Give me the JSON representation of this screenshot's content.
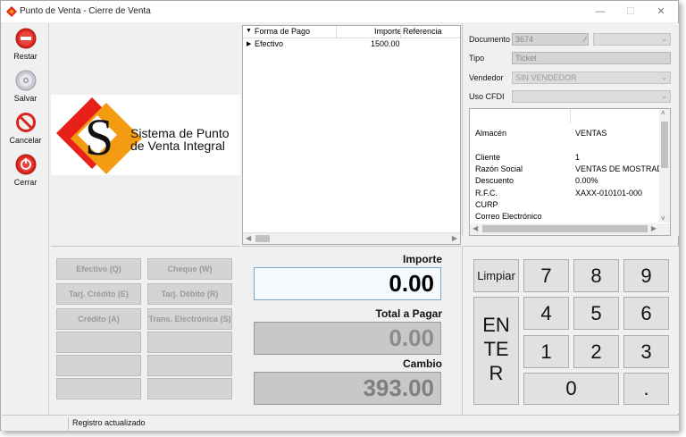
{
  "window": {
    "title": "Punto de Venta - Cierre de Venta",
    "minimize_glyph": "—",
    "maximize_glyph": "☐",
    "close_glyph": "✕"
  },
  "toolbar": {
    "items": [
      {
        "label": "Restar",
        "icon": "minus-circle-icon",
        "color": "#d9261c"
      },
      {
        "label": "Salvar",
        "icon": "disc-icon",
        "color": "#9a9aa6"
      },
      {
        "label": "Cancelar",
        "icon": "no-sign-icon",
        "color": "#d9261c"
      },
      {
        "label": "Cerrar",
        "icon": "power-circle-icon",
        "color": "#d9261c"
      }
    ]
  },
  "logo": {
    "line1": "Sistema de Punto",
    "line2": "de Venta Integral",
    "colors": {
      "red": "#e8201a",
      "orange": "#f39c12"
    }
  },
  "payment_buttons": [
    {
      "label": "Efectivo (Q)"
    },
    {
      "label": "Cheque (W)"
    },
    {
      "label": "Tarj. Crédito (E)"
    },
    {
      "label": "Tarj. Débito (R)"
    },
    {
      "label": "Crédito (A)"
    },
    {
      "label": "Trans. Electrónica (S)"
    },
    {
      "label": ""
    },
    {
      "label": ""
    },
    {
      "label": ""
    },
    {
      "label": ""
    },
    {
      "label": ""
    },
    {
      "label": ""
    }
  ],
  "payments_grid": {
    "headers": {
      "forma": "Forma de Pago",
      "importe": "Importe",
      "referencia": "Referencia"
    },
    "rows": [
      {
        "forma": "Efectivo",
        "importe": "1500.00",
        "referencia": ""
      }
    ]
  },
  "totals": {
    "importe_label": "Importe",
    "importe_value": "0.00",
    "total_label": "Total a Pagar",
    "total_value": "0.00",
    "cambio_label": "Cambio",
    "cambio_value": "393.00"
  },
  "info": {
    "documento_label": "Documento",
    "documento_value": "3674",
    "tipo_label": "Tipo",
    "tipo_value": "Ticket",
    "vendedor_label": "Vendedor",
    "vendedor_value": "SIN VENDEDOR",
    "uso_cfdi_label": "Uso CFDI",
    "uso_cfdi_value": "",
    "details": [
      {
        "label": "Almacén",
        "value": "VENTAS"
      },
      {
        "label": "Cliente",
        "value": "1"
      },
      {
        "label": "Razón Social",
        "value": "VENTAS DE MOSTRAD"
      },
      {
        "label": "Descuento",
        "value": "0.00%"
      },
      {
        "label": "R.F.C.",
        "value": "XAXX-010101-000"
      },
      {
        "label": "CURP",
        "value": ""
      },
      {
        "label": "Correo Electrónico",
        "value": ""
      }
    ]
  },
  "keypad": {
    "limpiar": "Limpiar",
    "enter_lines": [
      "EN",
      "TE",
      "R"
    ],
    "keys": [
      "7",
      "8",
      "9",
      "4",
      "5",
      "6",
      "1",
      "2",
      "3"
    ],
    "zero": "0",
    "dot": "."
  },
  "status": {
    "text": "Registro actualizado"
  }
}
